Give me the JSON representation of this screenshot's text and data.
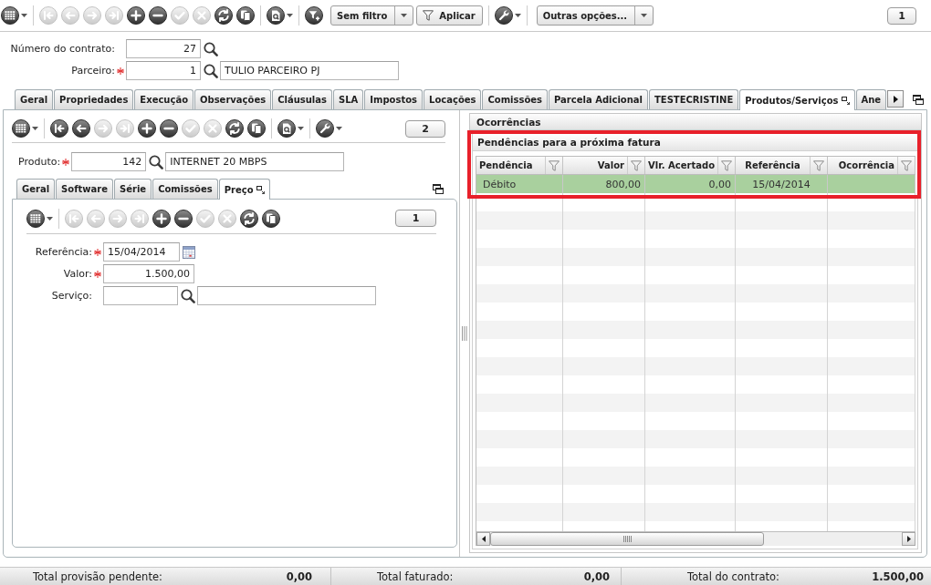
{
  "main_toolbar": {
    "groups": [
      [
        {
          "kind": "grid-menu",
          "disabled": false
        }
      ],
      [
        {
          "kind": "first",
          "disabled": true
        },
        {
          "kind": "previous",
          "disabled": true
        },
        {
          "kind": "next",
          "disabled": true
        },
        {
          "kind": "last",
          "disabled": true
        },
        {
          "kind": "add",
          "disabled": false
        },
        {
          "kind": "remove",
          "disabled": false
        },
        {
          "kind": "confirm",
          "disabled": true
        },
        {
          "kind": "cancel",
          "disabled": true
        },
        {
          "kind": "refresh",
          "disabled": false
        },
        {
          "kind": "copy",
          "disabled": false
        }
      ],
      [
        {
          "kind": "report-menu",
          "disabled": false
        }
      ],
      [
        {
          "kind": "filter-add",
          "disabled": false
        },
        {
          "kind": "dropdown",
          "label": "Sem filtro",
          "disabled": false
        },
        {
          "kind": "filter-button",
          "label": "Aplicar",
          "disabled": false
        }
      ],
      [
        {
          "kind": "tools-menu",
          "disabled": false
        }
      ],
      [
        {
          "kind": "dropdown",
          "label": "Outras opções...",
          "disabled": false
        }
      ]
    ],
    "record_badge": "1"
  },
  "contract_form": {
    "fields": [
      {
        "kind": "lookup",
        "label": "Número do contrato:",
        "required": false,
        "value": "27"
      },
      {
        "kind": "lookup-described",
        "label": "Parceiro:",
        "required": true,
        "value": "1",
        "description": "TULIO PARCEIRO PJ"
      }
    ]
  },
  "tabs": [
    {
      "label": "Geral",
      "selected": false
    },
    {
      "label": "Propriedades",
      "selected": false
    },
    {
      "label": "Execução",
      "selected": false
    },
    {
      "label": "Observações",
      "selected": false
    },
    {
      "label": "Cláusulas",
      "selected": false
    },
    {
      "label": "SLA",
      "selected": false
    },
    {
      "label": "Impostos",
      "selected": false
    },
    {
      "label": "Locações",
      "selected": false
    },
    {
      "label": "Comissões",
      "selected": false
    },
    {
      "label": "Parcela Adicional",
      "selected": false
    },
    {
      "label": "TESTECRISTINE",
      "selected": false
    },
    {
      "label": "Produtos/Serviços",
      "selected": true
    },
    {
      "label": "Ane",
      "selected": false
    }
  ],
  "products_panel": {
    "toolbar": {
      "groups": [
        [
          {
            "kind": "grid-menu",
            "disabled": false
          }
        ],
        [
          {
            "kind": "first",
            "disabled": false
          },
          {
            "kind": "previous",
            "disabled": false
          },
          {
            "kind": "next",
            "disabled": true
          },
          {
            "kind": "last",
            "disabled": true
          },
          {
            "kind": "add",
            "disabled": false
          },
          {
            "kind": "remove",
            "disabled": false
          },
          {
            "kind": "confirm",
            "disabled": true
          },
          {
            "kind": "cancel",
            "disabled": true
          },
          {
            "kind": "refresh",
            "disabled": false
          },
          {
            "kind": "copy",
            "disabled": false
          }
        ],
        [
          {
            "kind": "report-menu",
            "disabled": false
          }
        ],
        [
          {
            "kind": "tools-menu",
            "disabled": false
          }
        ]
      ],
      "record_badge": "2"
    },
    "fields": [
      {
        "kind": "lookup-described",
        "label": "Produto:",
        "required": true,
        "value": "142",
        "description": "INTERNET 20 MBPS"
      }
    ],
    "tabs": [
      {
        "label": "Geral",
        "selected": false
      },
      {
        "label": "Software",
        "selected": false
      },
      {
        "label": "Série",
        "selected": false
      },
      {
        "label": "Comissões",
        "selected": false
      },
      {
        "label": "Preço",
        "selected": true
      }
    ],
    "price_panel": {
      "toolbar": {
        "groups": [
          [
            {
              "kind": "grid-menu",
              "disabled": false
            }
          ],
          [
            {
              "kind": "first",
              "disabled": true
            },
            {
              "kind": "previous",
              "disabled": true
            },
            {
              "kind": "next",
              "disabled": true
            },
            {
              "kind": "last",
              "disabled": true
            },
            {
              "kind": "add",
              "disabled": false
            },
            {
              "kind": "remove",
              "disabled": false
            },
            {
              "kind": "confirm",
              "disabled": true
            },
            {
              "kind": "cancel",
              "disabled": true
            },
            {
              "kind": "refresh",
              "disabled": false
            },
            {
              "kind": "copy",
              "disabled": false
            }
          ]
        ],
        "record_badge": "1"
      },
      "fields": [
        {
          "kind": "date",
          "label": "Referência:",
          "required": true,
          "value": "15/04/2014"
        },
        {
          "kind": "number",
          "label": "Valor:",
          "required": true,
          "value": "1.500,00"
        },
        {
          "kind": "lookup-described",
          "label": "Serviço:",
          "required": false
        }
      ]
    }
  },
  "occurrences_panel": {
    "title": "Ocorrências",
    "section": {
      "title": "Pendências para a próxima fatura",
      "highlighted": true,
      "table": {
        "columns": [
          "Pendência",
          "Valor",
          "Vlr. Acertado",
          "Referência",
          "Ocorrência"
        ],
        "rows": [
          {
            "cells": [
              "Débito",
              "800,00",
              "0,00",
              "15/04/2014"
            ],
            "selected": true
          }
        ]
      }
    }
  },
  "totals": [
    {
      "label": "Total provisão pendente:",
      "value": "0,00"
    },
    {
      "label": "Total faturado:",
      "value": "0,00"
    },
    {
      "label": "Total do contrato:",
      "value": "1.500,00"
    }
  ]
}
